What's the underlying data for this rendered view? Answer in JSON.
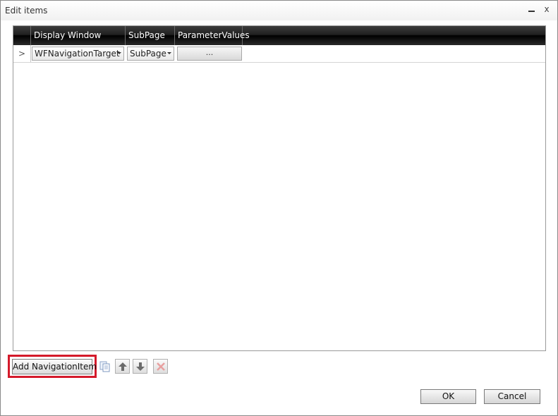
{
  "window": {
    "title": "Edit items",
    "minimize_glyph": "",
    "close_glyph": "x"
  },
  "grid": {
    "columns": [
      "Display Window",
      "SubPage",
      "ParameterValues"
    ],
    "rows": [
      {
        "indicator": ">",
        "display_window": "WFNavigationTarget",
        "subpage": "SubPage",
        "parameter_values": "..."
      }
    ]
  },
  "toolbar": {
    "add_label": "Add NavigationItem",
    "icons": [
      "copy-icon",
      "arrow-up-icon",
      "arrow-down-icon",
      "delete-icon"
    ],
    "highlight_color": "#d41a2b"
  },
  "footer": {
    "ok_label": "OK",
    "cancel_label": "Cancel"
  }
}
